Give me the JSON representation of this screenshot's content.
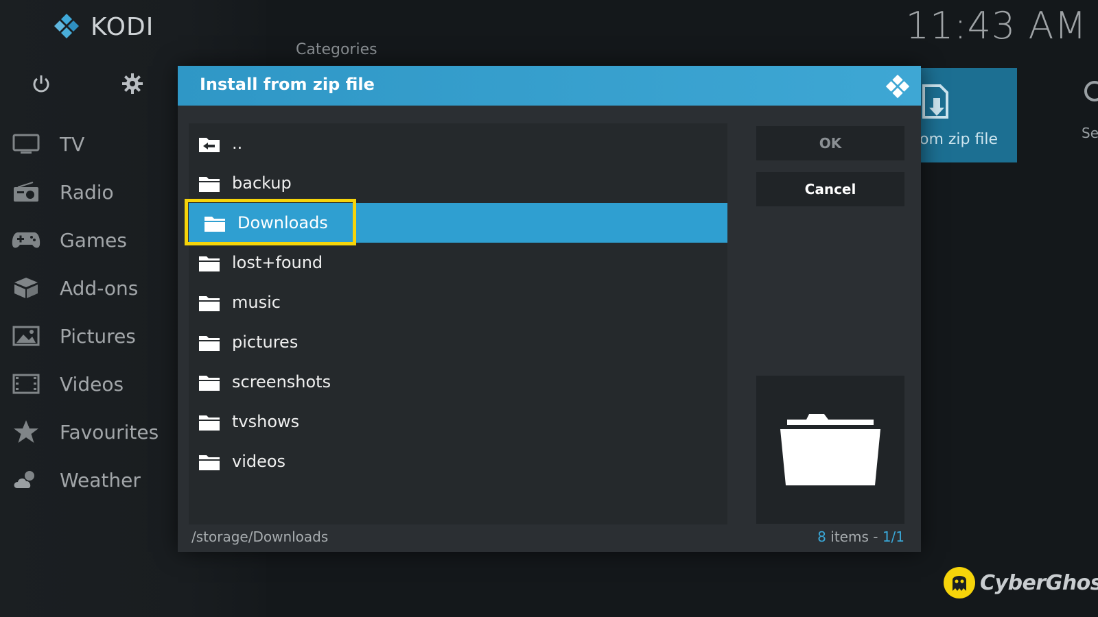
{
  "app": {
    "name": "KODI",
    "clock": "11:43 AM"
  },
  "sidebar": {
    "items": [
      {
        "label": "TV",
        "icon": "tv-icon"
      },
      {
        "label": "Radio",
        "icon": "radio-icon"
      },
      {
        "label": "Games",
        "icon": "gamepad-icon"
      },
      {
        "label": "Add-ons",
        "icon": "box-icon"
      },
      {
        "label": "Pictures",
        "icon": "image-icon"
      },
      {
        "label": "Videos",
        "icon": "film-icon"
      },
      {
        "label": "Favourites",
        "icon": "star-icon"
      },
      {
        "label": "Weather",
        "icon": "cloud-sun-icon"
      }
    ]
  },
  "background": {
    "section_title": "Categories",
    "tile_label": "om zip file",
    "right_partial": "Se"
  },
  "dialog": {
    "title": "Install from zip file",
    "files": [
      {
        "label": "..",
        "icon": "back-folder-icon"
      },
      {
        "label": "backup",
        "icon": "folder-icon"
      },
      {
        "label": "Downloads",
        "icon": "folder-icon",
        "selected": true
      },
      {
        "label": "lost+found",
        "icon": "folder-icon"
      },
      {
        "label": "music",
        "icon": "folder-icon"
      },
      {
        "label": "pictures",
        "icon": "folder-icon"
      },
      {
        "label": "screenshots",
        "icon": "folder-icon"
      },
      {
        "label": "tvshows",
        "icon": "folder-icon"
      },
      {
        "label": "videos",
        "icon": "folder-icon"
      }
    ],
    "ok_label": "OK",
    "cancel_label": "Cancel",
    "path": "/storage/Downloads",
    "count_num": "8",
    "count_mid": " items - ",
    "count_page": "1/1"
  },
  "watermark": {
    "text": "CyberGhost"
  },
  "colors": {
    "accent": "#2f9fd1",
    "highlight": "#f6d40a",
    "dialog_bg": "#2b2f33"
  }
}
